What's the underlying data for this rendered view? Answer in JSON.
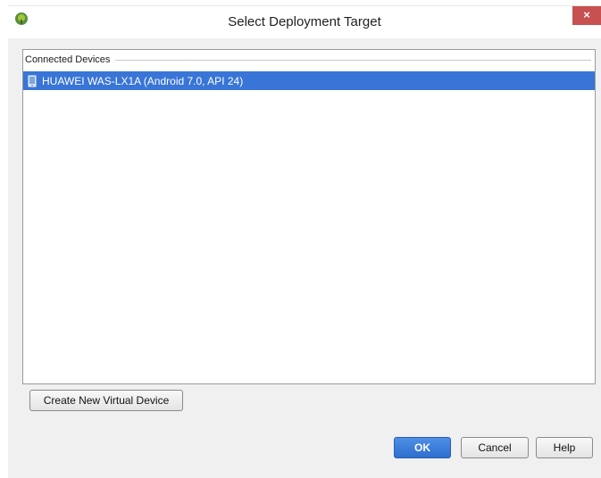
{
  "window": {
    "title": "Select Deployment Target",
    "close_glyph": "×",
    "app_icon": "android-studio-icon"
  },
  "devices": {
    "section_label": "Connected Devices",
    "items": [
      {
        "label": "HUAWEI WAS-LX1A (Android 7.0, API 24)",
        "icon": "phone-device-icon",
        "selected": true
      }
    ]
  },
  "buttons": {
    "create_virtual_device": "Create New Virtual Device",
    "ok": "OK",
    "cancel": "Cancel",
    "help": "Help"
  },
  "colors": {
    "selection": "#3875d7",
    "ok_button": "#2f6fcf",
    "close_button": "#c75050"
  }
}
